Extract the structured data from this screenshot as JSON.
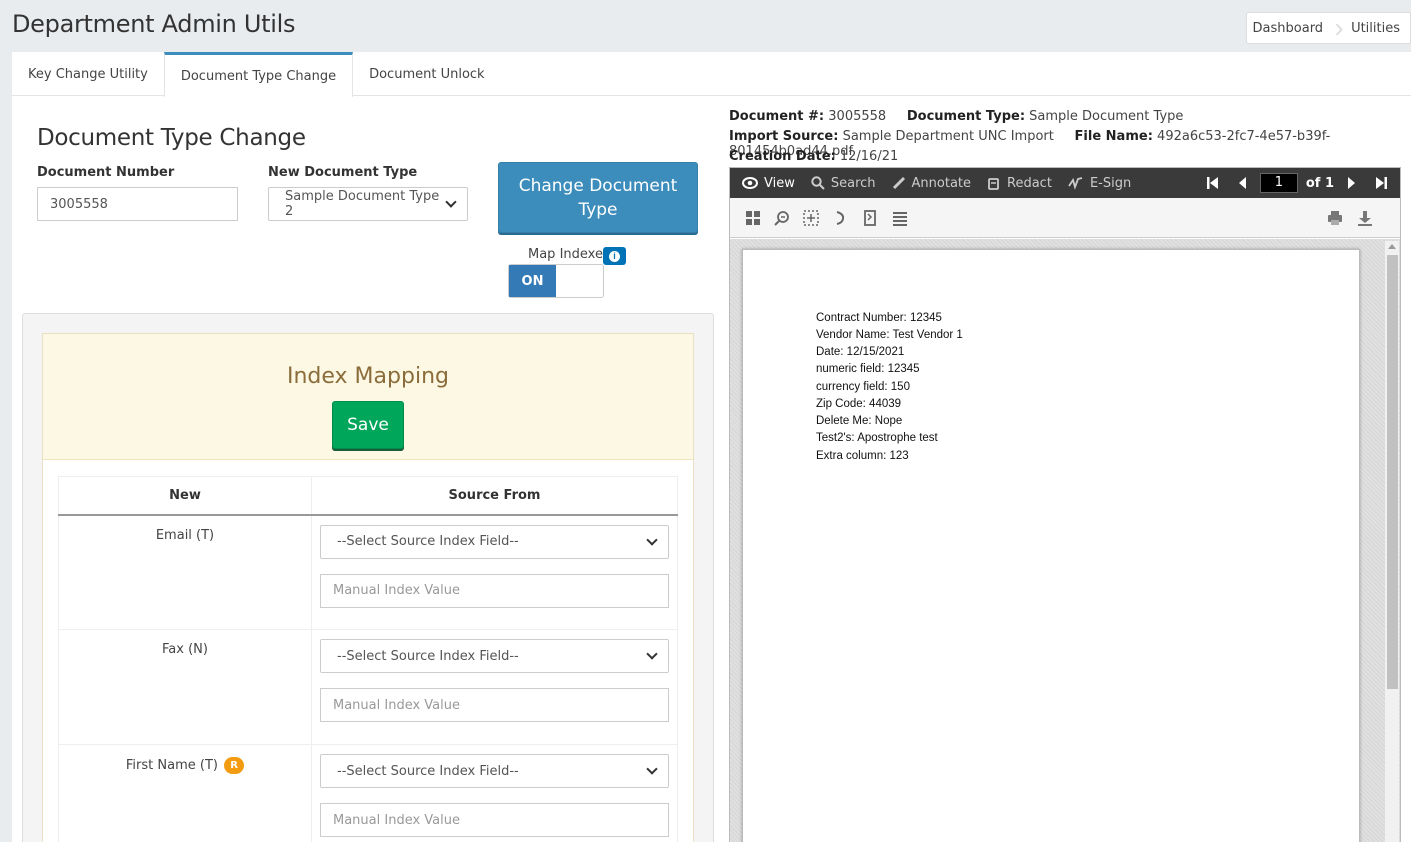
{
  "header": {
    "title": "Department Admin Utils"
  },
  "breadcrumb": [
    "Dashboard",
    "Utilities"
  ],
  "tabs": [
    {
      "label": "Key Change Utility",
      "active": false
    },
    {
      "label": "Document Type Change",
      "active": true
    },
    {
      "label": "Document Unlock",
      "active": false
    }
  ],
  "form": {
    "section_title": "Document Type Change",
    "doc_number_label": "Document Number",
    "doc_number_value": "3005558",
    "new_type_label": "New Document Type",
    "new_type_value": "Sample Document Type 2",
    "change_button": "Change Document Type",
    "map_indexes_label": "Map Indexes",
    "toggle_state": "ON"
  },
  "index_mapping": {
    "title": "Index Mapping",
    "save_label": "Save",
    "columns": [
      "New",
      "Source From"
    ],
    "rows": [
      {
        "name": "Email (T)",
        "required_badge": "",
        "select": "--Select Source Index Field--",
        "placeholder": "Manual Index Value"
      },
      {
        "name": "Fax (N)",
        "required_badge": "",
        "select": "--Select Source Index Field--",
        "placeholder": "Manual Index Value"
      },
      {
        "name": "First Name (T)",
        "required_badge": "R",
        "select": "--Select Source Index Field--",
        "placeholder": "Manual Index Value"
      }
    ]
  },
  "doc_meta": {
    "doc_num_label": "Document #:",
    "doc_num": "3005558",
    "doc_type_label": "Document Type:",
    "doc_type": "Sample Document Type",
    "import_label": "Import Source:",
    "import_source": "Sample Department UNC Import",
    "file_label": "File Name:",
    "file_name": "492a6c53-2fc7-4e57-b39f-801454b0ad44.pdf",
    "created_label": "Creation Date:",
    "created": "12/16/21"
  },
  "viewer": {
    "tools": [
      "View",
      "Search",
      "Annotate",
      "Redact",
      "E-Sign"
    ],
    "page_current": "1",
    "page_total": "of 1",
    "content_lines": [
      "Contract Number: 12345",
      "Vendor Name: Test Vendor 1",
      "Date: 12/15/2021",
      "numeric field: 12345",
      "currency field: 150",
      "Zip Code: 44039",
      "Delete Me: Nope",
      "Test2's: Apostrophe test",
      "Extra column: 123"
    ]
  },
  "colors": {
    "primary": "#3c8dbc",
    "success": "#00a65a",
    "warning_bg": "#fcf8e3",
    "badge": "#f39c12"
  }
}
